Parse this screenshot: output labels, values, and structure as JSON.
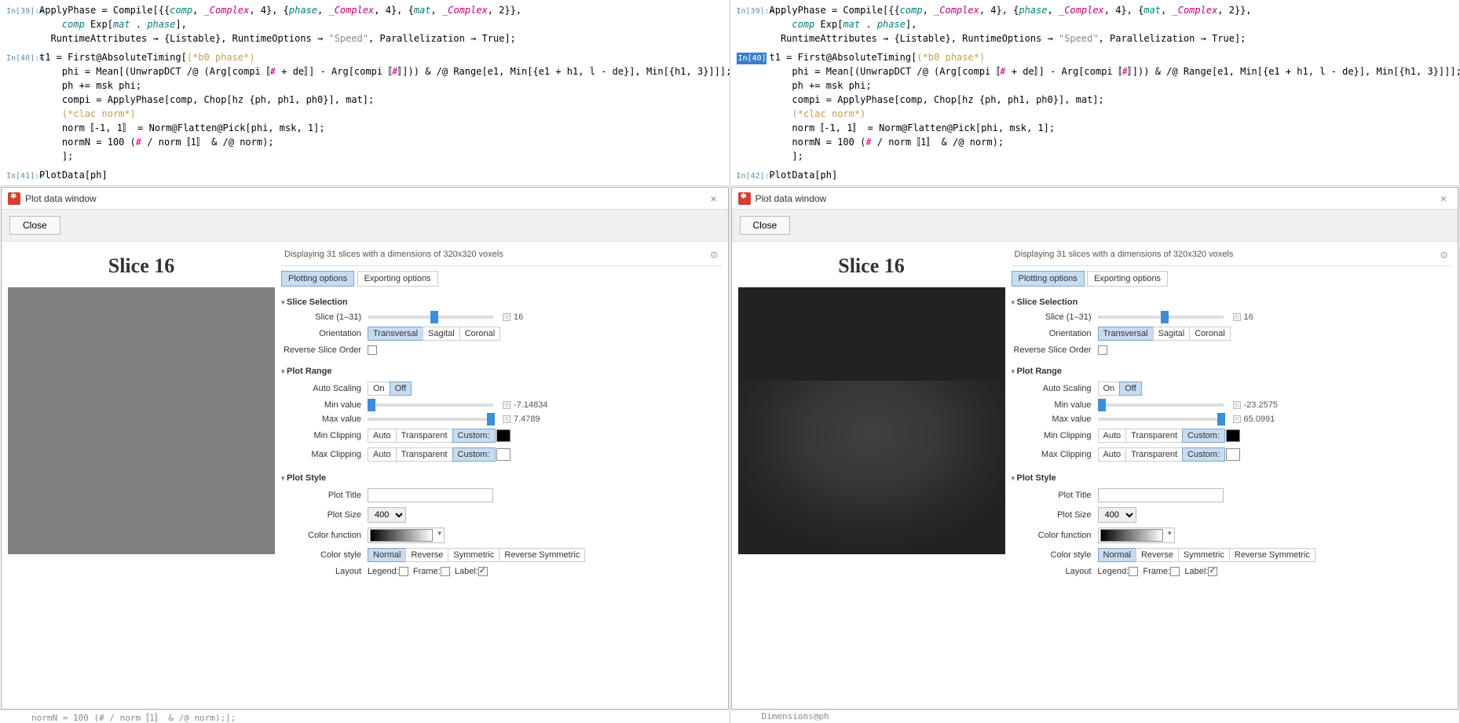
{
  "left": {
    "code": {
      "in39_label": "In[39]:=",
      "in39_l1_a": "ApplyPhase = Compile[{{",
      "in39_l1_comp": "comp",
      "in39_l1_b": ", ",
      "in39_l1_complex": "_Complex",
      "in39_l1_c": ", 4}, {",
      "in39_l1_phase": "phase",
      "in39_l1_d": ", ",
      "in39_l1_e": ", 4}, {",
      "in39_l1_mat": "mat",
      "in39_l1_f": ", ",
      "in39_l1_g": ", 2}},",
      "in39_l2_a": "comp",
      "in39_l2_b": " Exp[",
      "in39_l2_c": "mat",
      "in39_l2_d": " . ",
      "in39_l2_e": "phase",
      "in39_l2_f": "],",
      "in39_l3_a": "RuntimeAttributes → {Listable}, RuntimeOptions → ",
      "in39_l3_b": "\"Speed\"",
      "in39_l3_c": ", Parallelization → True];",
      "in40_label": "In[40]:=",
      "in40_l1": "t1 = First@AbsoluteTiming[",
      "in40_l1_comment": "(*b0 phase*)",
      "in40_l2_a": "phi = Mean[(UnwrapDCT /@ (Arg[compi〚",
      "in40_l2_b": "#",
      "in40_l2_c": " + de〛] - Arg[compi〚",
      "in40_l2_d": "#",
      "in40_l2_e": "〛])) & /@ Range[e1, Min[{e1 + h1, l - de}], Min[{h1, 3}]]];",
      "in40_l3": "ph += msk phi;",
      "in40_l4": "compi = ApplyPhase[comp, Chop[hz {ph, ph1, ph0}], mat];",
      "in40_l5_comment": "(*clac norm*)",
      "in40_l6": "norm〚-1, 1〛 = Norm@Flatten@Pick[phi, msk, 1];",
      "in40_l7_a": "normN = 100 (",
      "in40_l7_b": "#",
      "in40_l7_c": " / norm〚1〛 & /@ norm);",
      "in40_l8": "];",
      "in41_label": "In[41]:=",
      "in41_l1": "PlotData[ph]"
    },
    "plot": {
      "window_title": "Plot data window",
      "close_btn": "Close",
      "info_text": "Displaying 31 slices with a dimensions of 320x320 voxels",
      "tab_plotting": "Plotting options",
      "tab_exporting": "Exporting options",
      "slice_title": "Slice 16",
      "sec_slice": "Slice Selection",
      "slice_label": "Slice (1–31)",
      "slice_value": "16",
      "orientation_label": "Orientation",
      "orient_trans": "Transversal",
      "orient_sag": "Sagital",
      "orient_cor": "Coronal",
      "reverse_label": "Reverse Slice Order",
      "sec_range": "Plot Range",
      "autoscale_label": "Auto Scaling",
      "on": "On",
      "off": "Off",
      "minval_label": "Min value",
      "minval": "-7.14834",
      "maxval_label": "Max value",
      "maxval": "7.4789",
      "minclip_label": "Min Clipping",
      "maxclip_label": "Max Clipping",
      "clip_auto": "Auto",
      "clip_trans": "Transparent",
      "clip_custom": "Custom:",
      "sec_style": "Plot Style",
      "plottitle_label": "Plot Title",
      "plotsize_label": "Plot Size",
      "plotsize_val": "400",
      "colorfunc_label": "Color function",
      "colorstyle_label": "Color style",
      "cs_normal": "Normal",
      "cs_reverse": "Reverse",
      "cs_sym": "Symmetric",
      "cs_rsym": "Reverse Symmetric",
      "layout_label": "Layout",
      "lay_legend": "Legend:",
      "lay_frame": "Frame:",
      "lay_label": "Label:"
    },
    "bottom_cut": "normN = 100 (# / norm〚1〛 & /@ norm);];"
  },
  "right": {
    "code": {
      "in39_label": "In[39]:=",
      "in40_label": "In[40]:=",
      "in42_label": "In[42]:=",
      "in42_l1": "PlotData[ph]"
    },
    "plot": {
      "window_title": "Plot data window",
      "close_btn": "Close",
      "info_text": "Displaying 31 slices with a dimensions of 320x320 voxels",
      "slice_title": "Slice 16",
      "slice_value": "16",
      "minval": "-23.2575",
      "maxval": "65.0991"
    },
    "bottom_cut": "Dimensions@ph"
  }
}
